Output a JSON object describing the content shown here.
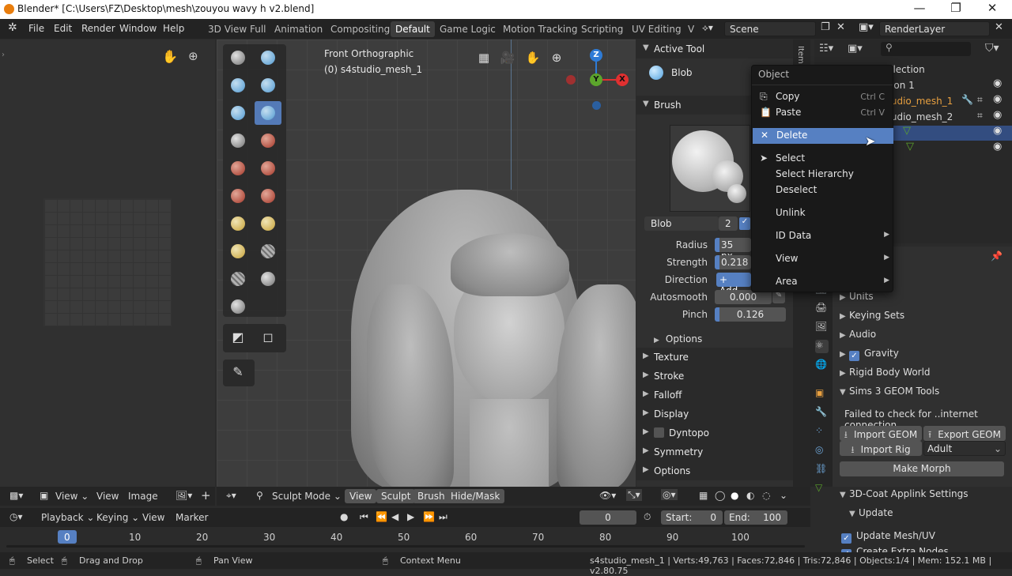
{
  "window": {
    "title": "Blender* [C:\\Users\\FZ\\Desktop\\mesh\\zouyou wavy h v2.blend]",
    "minimize": "—",
    "restore": "❐",
    "close": "✕"
  },
  "menubar": {
    "items": [
      "File",
      "Edit",
      "Render",
      "Window",
      "Help"
    ],
    "workspaces": [
      "3D View Full",
      "Animation",
      "Compositing",
      "Default",
      "Game Logic",
      "Motion Tracking",
      "Scripting",
      "UV Editing",
      "V"
    ],
    "active_workspace": "Default",
    "scene": "Scene",
    "render_layer": "RenderLayer"
  },
  "viewport": {
    "view_name": "Front Orthographic",
    "object_name": "(0) s4studio_mesh_1",
    "gizmo": {
      "z": "Z",
      "y": "Y",
      "x": "X"
    }
  },
  "tool_settings": {
    "active_tool_header": "Active Tool",
    "active_tool": "Blob",
    "brush_header": "Brush",
    "brush_name": "Blob",
    "brush_users": "2",
    "radius_label": "Radius",
    "radius_value": "35 px",
    "strength_label": "Strength",
    "strength_value": "0.218",
    "direction_label": "Direction",
    "direction_value": "+ Add",
    "autosmooth_label": "Autosmooth",
    "autosmooth_value": "0.000",
    "pinch_label": "Pinch",
    "pinch_value": "0.126",
    "options_label": "Options",
    "sections": [
      "Texture",
      "Stroke",
      "Falloff",
      "Display",
      "Dyntopo",
      "Symmetry",
      "Options"
    ]
  },
  "outliner": {
    "rows": [
      "Scene Collection",
      "Collection 1",
      "s4studio_mesh_1",
      "s4studio_mesh_2"
    ]
  },
  "context_menu": {
    "title": "Object",
    "items": [
      {
        "label": "Copy",
        "shortcut": "Ctrl C"
      },
      {
        "label": "Paste",
        "shortcut": "Ctrl V"
      },
      {
        "label": "Delete",
        "shortcut": ""
      },
      {
        "label": "Select",
        "shortcut": ""
      },
      {
        "label": "Select Hierarchy",
        "shortcut": ""
      },
      {
        "label": "Deselect",
        "shortcut": ""
      },
      {
        "label": "Unlink",
        "shortcut": ""
      },
      {
        "label": "ID Data",
        "shortcut": ""
      },
      {
        "label": "View",
        "shortcut": ""
      },
      {
        "label": "Area",
        "shortcut": ""
      }
    ]
  },
  "properties": {
    "rows": [
      "Units",
      "Keying Sets",
      "Audio",
      "Gravity",
      "Rigid Body World",
      "Sims 3 GEOM Tools"
    ],
    "geom_status": "Failed to check for ..internet connection.",
    "import_geom": "Import GEOM",
    "export_geom": "Export GEOM",
    "import_rig": "Import Rig",
    "rig_type": "Adult",
    "make_morph": "Make Morph",
    "applink_header": "3D-Coat Applink Settings",
    "update_header": "Update",
    "update_mesh": "Update Mesh/UV",
    "create_extra": "Create Extra Nodes"
  },
  "image_editor_header": {
    "view1": "View",
    "view2": "View",
    "image": "Image"
  },
  "viewport_header": {
    "mode": "Sculpt Mode",
    "view": "View",
    "sculpt": "Sculpt",
    "brush": "Brush",
    "hide_mask": "Hide/Mask"
  },
  "timeline_header": {
    "playback": "Playback",
    "keying": "Keying",
    "view": "View",
    "marker": "Marker",
    "current_frame": "0",
    "start_label": "Start:",
    "start": "0",
    "end_label": "End:",
    "end": "100"
  },
  "timeline": {
    "ticks": [
      "0",
      "10",
      "20",
      "30",
      "40",
      "50",
      "60",
      "70",
      "80",
      "90",
      "100"
    ]
  },
  "statusbar": {
    "select": "Select",
    "drag": "Drag and Drop",
    "pan": "Pan View",
    "context": "Context Menu",
    "stats": "s4studio_mesh_1 | Verts:49,763 | Faces:72,846 | Tris:72,846 | Objects:1/4 | Mem: 152.1 MB | v2.80.75"
  },
  "colors": {
    "accent": "#5680c2",
    "background": "#2b2b2b",
    "axis_x": "#e03030",
    "axis_y": "#5ca52c",
    "axis_z": "#2e7bd6",
    "highlight_name": "#e8a040"
  }
}
